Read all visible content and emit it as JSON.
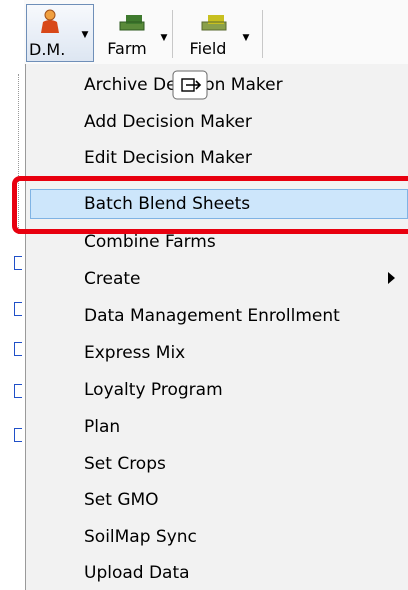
{
  "toolbar": {
    "dm_label": "D.M.",
    "farm_label": "Farm",
    "field_label": "Field"
  },
  "menu": {
    "items": [
      {
        "label": "Archive Decision Maker"
      },
      {
        "label": "Add Decision Maker"
      },
      {
        "label": "Edit Decision Maker"
      },
      {
        "label": "Batch Blend Sheets"
      },
      {
        "label": "Combine Farms"
      },
      {
        "label": "Create"
      },
      {
        "label": "Data Management Enrollment"
      },
      {
        "label": "Express Mix"
      },
      {
        "label": "Loyalty Program"
      },
      {
        "label": "Plan"
      },
      {
        "label": "Set Crops"
      },
      {
        "label": "Set GMO"
      },
      {
        "label": "SoilMap Sync"
      },
      {
        "label": "Upload Data"
      }
    ],
    "highlighted_item": "Batch Blend Sheets"
  },
  "colors": {
    "highlight_fill": "#cde6fb",
    "highlight_border": "#7fb3e4",
    "annotation_red": "#e8000f",
    "menu_background": "#f2f2f2"
  },
  "icons": {
    "dm": "person-icon",
    "farm": "farm-icon",
    "field": "field-icon",
    "cursor": "drag-cursor-icon"
  }
}
